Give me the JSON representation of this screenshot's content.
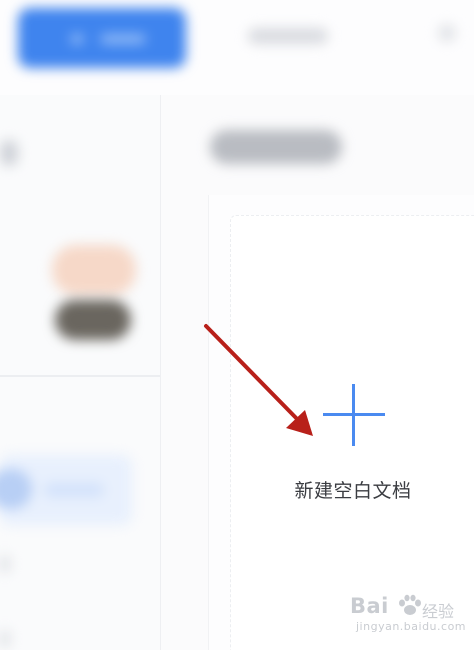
{
  "new_document": {
    "label": "新建空白文档"
  },
  "watermark": {
    "brand": "Bai",
    "brand_cn": "经验",
    "url": "jingyan.baidu.com"
  },
  "colors": {
    "accent": "#4a8af0",
    "annotation_arrow": "#b8201a",
    "background": "#fbfbfc"
  },
  "icons": {
    "new_document": "plus-icon",
    "annotation": "arrow-annotation-icon",
    "watermark": "paw-icon"
  }
}
